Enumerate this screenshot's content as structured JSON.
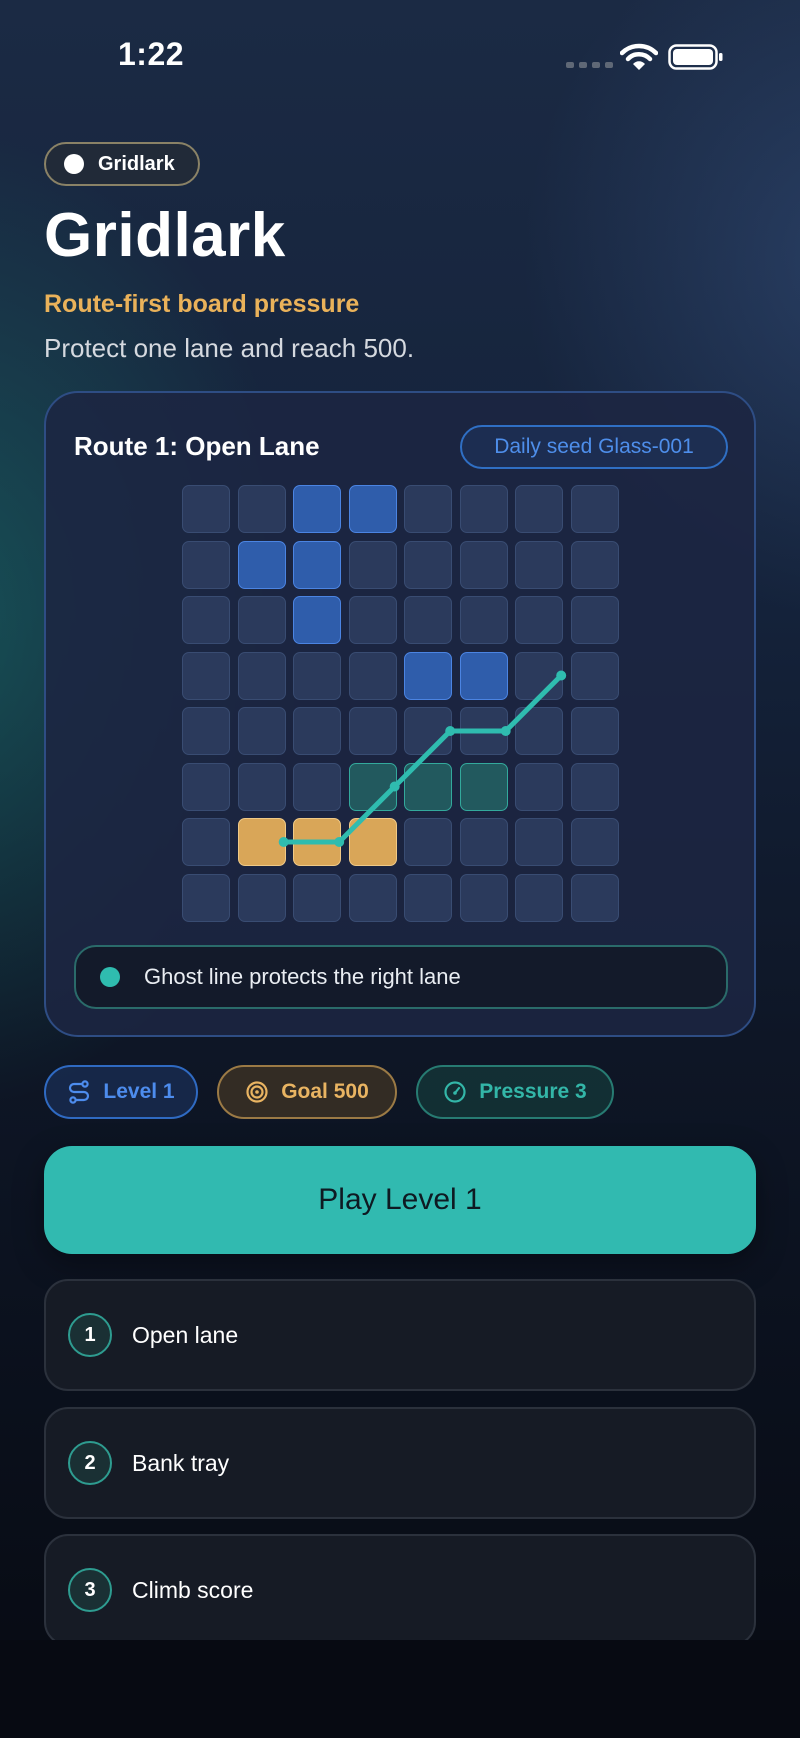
{
  "status_bar": {
    "time": "1:22"
  },
  "header": {
    "chip_label": "Gridlark",
    "title": "Gridlark",
    "subtitle": "Route-first board pressure",
    "description": "Protect one lane and reach 500."
  },
  "board": {
    "route_title": "Route 1: Open Lane",
    "seed_label": "Daily seed Glass-001",
    "hint": "Ghost line protects the right lane",
    "grid_size": 8,
    "blue_cells": [
      [
        0,
        2
      ],
      [
        0,
        3
      ],
      [
        1,
        1
      ],
      [
        1,
        2
      ],
      [
        2,
        2
      ],
      [
        3,
        4
      ],
      [
        3,
        5
      ]
    ],
    "teal_cells": [
      [
        5,
        3
      ],
      [
        5,
        4
      ],
      [
        5,
        5
      ]
    ],
    "orange_cells": [
      [
        6,
        1
      ],
      [
        6,
        2
      ],
      [
        6,
        3
      ]
    ],
    "route_points": [
      [
        6,
        1.4
      ],
      [
        6,
        2.4
      ],
      [
        5,
        3.4
      ],
      [
        4,
        4.4
      ],
      [
        4,
        5.4
      ],
      [
        3,
        6.4
      ]
    ],
    "colors": {
      "blue": "#2f5dab",
      "teal": "#22595e",
      "orange": "#d9a658",
      "route": "#2fbcaf"
    }
  },
  "stats": {
    "level": "Level 1",
    "goal": "Goal 500",
    "pressure": "Pressure 3"
  },
  "play_button": "Play Level 1",
  "steps": [
    {
      "number": "1",
      "label": "Open lane"
    },
    {
      "number": "2",
      "label": "Bank tray"
    },
    {
      "number": "3",
      "label": "Climb score"
    }
  ]
}
